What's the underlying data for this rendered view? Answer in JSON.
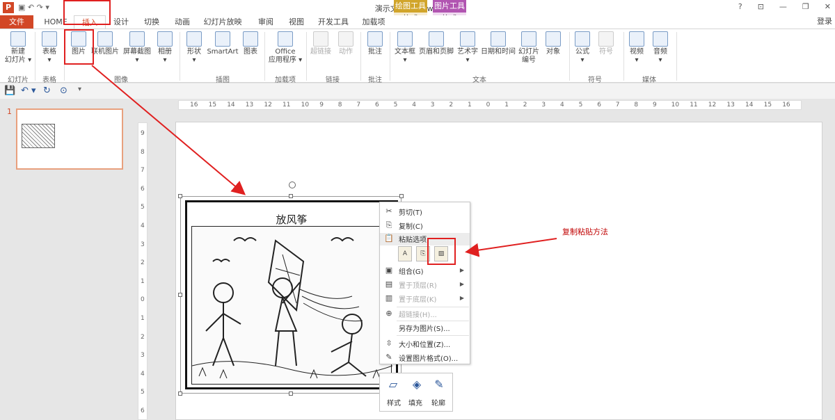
{
  "titlebar": {
    "app_icon": "P",
    "title": "演示文稿1 - PowerPoint",
    "qat_glyphs": "▣ ↶ ↷ ▾",
    "help": "?",
    "ribbon_display": "⊡",
    "minimize": "—",
    "restore": "❐",
    "close": "✕",
    "login": "登录"
  },
  "context_groups": {
    "draw_header": "绘图工具",
    "draw_tab": "格式",
    "pic_header": "图片工具",
    "pic_tab": "格式"
  },
  "tabs": [
    "文件",
    "HOME",
    "插入",
    "设计",
    "切换",
    "动画",
    "幻灯片放映",
    "审阅",
    "视图",
    "开发工具",
    "加载项"
  ],
  "ribbon": {
    "buttons": [
      "新建\n幻灯片 ▾",
      "表格\n▾",
      "图片",
      "联机图片",
      "屏幕截图\n▾",
      "相册\n▾",
      "形状\n▾",
      "SmartArt",
      "图表",
      "Office\n应用程序 ▾",
      "超链接",
      "动作",
      "批注",
      "文本框\n▾",
      "页眉和页脚",
      "艺术字\n▾",
      "日期和时间",
      "幻灯片\n编号",
      "对象",
      "公式\n▾",
      "符号",
      "视频\n▾",
      "音频\n▾"
    ],
    "groups": [
      "幻灯片",
      "表格",
      "图像",
      "插图",
      "加载项",
      "链接",
      "批注",
      "文本",
      "符号",
      "媒体"
    ]
  },
  "qat": {
    "save": "💾",
    "undo": "↶ ▾",
    "redo": "↻",
    "start": "⊙",
    "more": "▾"
  },
  "thumbnail": {
    "number": "1"
  },
  "ruler": {
    "h_ticks": [
      "16",
      "15",
      "14",
      "13",
      "12",
      "11",
      "10",
      "9",
      "8",
      "7",
      "6",
      "5",
      "4",
      "3",
      "2",
      "1",
      "0",
      "1",
      "2",
      "3",
      "4",
      "5",
      "6",
      "7",
      "8",
      "9",
      "10",
      "11",
      "12",
      "13",
      "14",
      "15",
      "16"
    ],
    "v_ticks": [
      "9",
      "8",
      "7",
      "6",
      "5",
      "4",
      "3",
      "2",
      "1",
      "0",
      "1",
      "2",
      "3",
      "4",
      "5",
      "6"
    ]
  },
  "picture": {
    "title": "放风筝"
  },
  "context_menu": {
    "items": [
      {
        "icon": "✂",
        "label": "剪切(T)",
        "enabled": true,
        "submenu": false
      },
      {
        "icon": "⎘",
        "label": "复制(C)",
        "enabled": true,
        "submenu": false
      },
      {
        "icon": "📋",
        "label": "粘贴选项:",
        "enabled": true,
        "submenu": false
      },
      {
        "icon": "▣",
        "label": "组合(G)",
        "enabled": true,
        "submenu": true
      },
      {
        "icon": "▤",
        "label": "置于顶层(R)",
        "enabled": false,
        "submenu": true
      },
      {
        "icon": "▥",
        "label": "置于底层(K)",
        "enabled": false,
        "submenu": true
      },
      {
        "icon": "⊕",
        "label": "超链接(H)...",
        "enabled": false,
        "submenu": false
      },
      {
        "icon": "",
        "label": "另存为图片(S)...",
        "enabled": true,
        "submenu": false
      },
      {
        "icon": "⇳",
        "label": "大小和位置(Z)...",
        "enabled": true,
        "submenu": false
      },
      {
        "icon": "✎",
        "label": "设置图片格式(O)...",
        "enabled": true,
        "submenu": false
      }
    ],
    "paste_options": [
      "A",
      "⎘",
      "▨"
    ],
    "submenu_arrow": "▶"
  },
  "mini_toolbar": {
    "style_icon": "▱",
    "fill_icon": "◈",
    "outline_icon": "✎",
    "style": "样式",
    "fill": "填充",
    "outline": "轮廓"
  },
  "annotation": {
    "text": "复制粘贴方法"
  },
  "colors": {
    "accent": "#d24726",
    "annotation_red": "#e02020"
  }
}
